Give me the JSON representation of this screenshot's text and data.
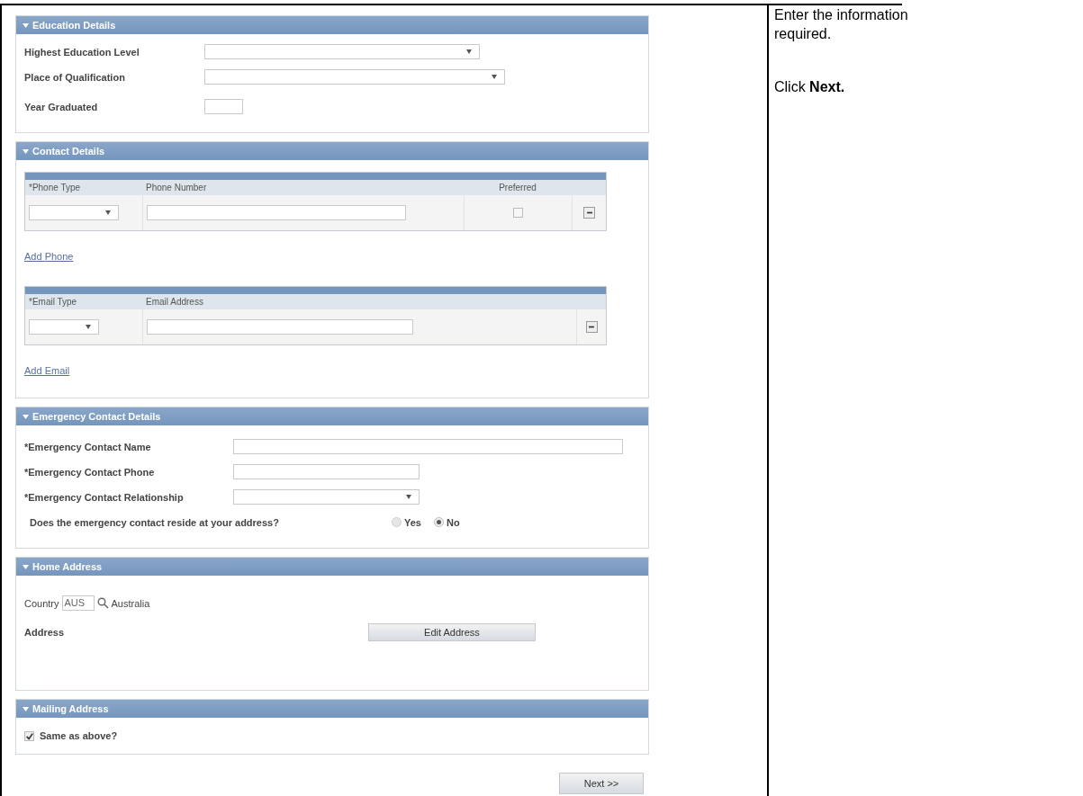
{
  "sections": [
    {
      "kind": "fields",
      "title": "Education Details",
      "expanded": true,
      "fields": [
        {
          "kind": "select",
          "label": "Highest Education Level"
        },
        {
          "kind": "select",
          "label": "Place of Qualification"
        },
        {
          "kind": "text",
          "label": "Year Graduated"
        }
      ]
    },
    {
      "kind": "contact",
      "title": "Contact Details",
      "expanded": true,
      "grids": [
        {
          "columns": [
            "*Phone Type",
            "Phone Number",
            "Preferred"
          ],
          "preferred_checked": false,
          "link": "Add Phone"
        },
        {
          "columns": [
            "*Email Type",
            "Email Address"
          ],
          "link": "Add Email"
        }
      ]
    },
    {
      "kind": "emergency",
      "title": "Emergency Contact Details",
      "expanded": true,
      "fields": [
        {
          "kind": "text",
          "label": "*Emergency Contact Name"
        },
        {
          "kind": "text",
          "label": "*Emergency Contact Phone"
        },
        {
          "kind": "select",
          "label": "*Emergency Contact Relationship"
        }
      ],
      "question": "Does the emergency contact reside at your address?",
      "options": [
        {
          "label": "Yes",
          "selected": false
        },
        {
          "label": "No",
          "selected": true
        }
      ]
    },
    {
      "kind": "home",
      "title": "Home Address",
      "expanded": true,
      "country_label": "Country",
      "country_code": "AUS",
      "country_name": "Australia",
      "address_label": "Address",
      "button": "Edit Address"
    },
    {
      "kind": "mailing",
      "title": "Mailing Address",
      "expanded": true,
      "checkbox": {
        "label": "Same as above?",
        "checked": true
      }
    }
  ],
  "next_button": "Next >>",
  "instructions": [
    "Enter the information required.",
    "Click **Next.**"
  ]
}
